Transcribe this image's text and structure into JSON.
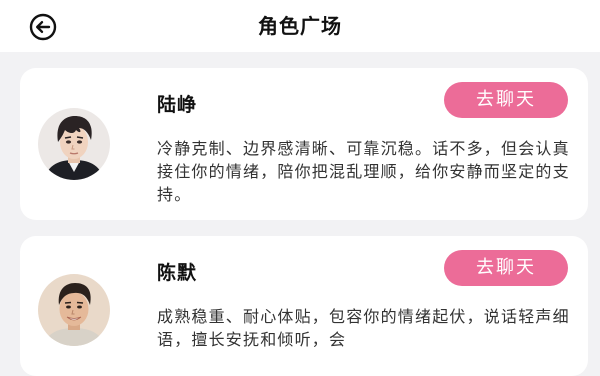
{
  "header": {
    "title": "角色广场",
    "back_icon": "back-arrow-circle-icon"
  },
  "characters": [
    {
      "name": "陆峥",
      "chat_label": "去聊天",
      "description": "冷静克制、边界感清晰、可靠沉稳。话不多，但会认真接住你的情绪，陪你把混乱理顺，给你安静而坚定的支持。"
    },
    {
      "name": "陈默",
      "chat_label": "去聊天",
      "description": "成熟稳重、耐心体贴，包容你的情绪起伏，说话轻声细语，擅长安抚和倾听，会"
    }
  ],
  "colors": {
    "accent": "#ec6c98",
    "background": "#f2f2f4",
    "card": "#ffffff"
  }
}
